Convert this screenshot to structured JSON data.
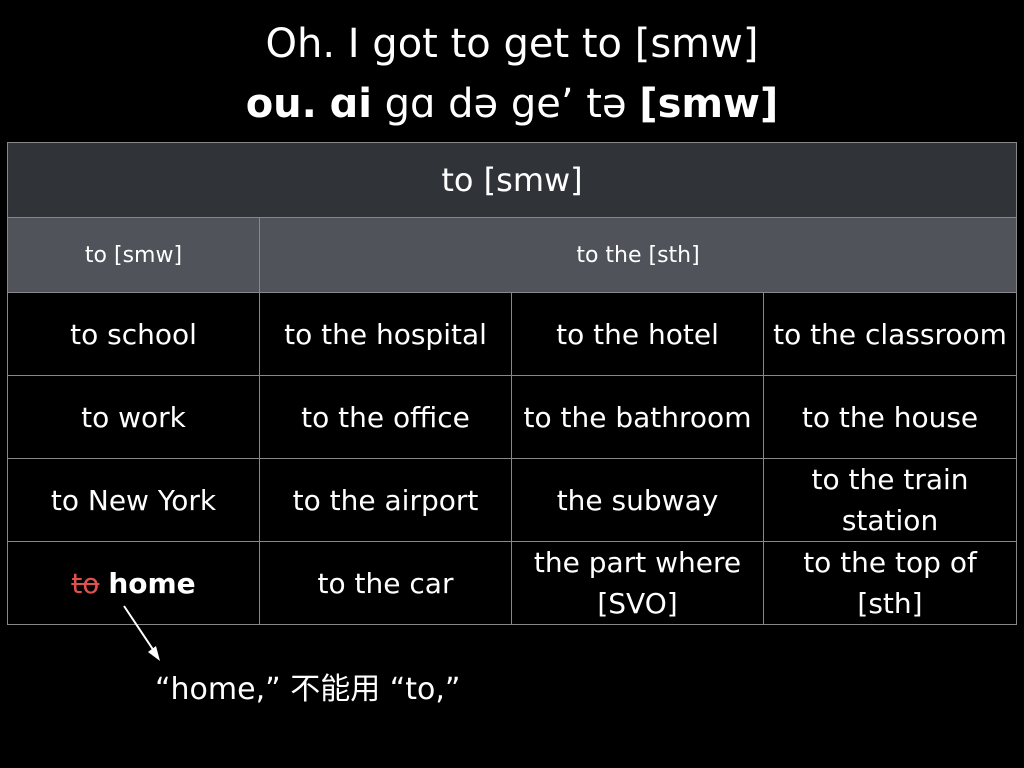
{
  "slide": {
    "title_line1": "Oh. I got to get to [smw]",
    "title_line2": {
      "part1_bold": "ou.",
      "part2": " ",
      "part3_bold": "ɑi",
      "part4": " gɑ də ge’ tə ",
      "part5_bold": "[smw]"
    }
  },
  "table": {
    "header": "to [smw]",
    "subheaders": [
      "to [smw]",
      "to the [sth]"
    ],
    "rows": [
      [
        "to school",
        "to the hospital",
        "to the hotel",
        "to the classroom"
      ],
      [
        "to work",
        "to the office",
        "to the bathroom",
        "to the house"
      ],
      [
        "to New York",
        "to the airport",
        "the subway",
        "to the train station"
      ],
      [
        "",
        "to the car",
        "the part where [SVO]",
        "to the top of [sth]"
      ]
    ],
    "special_cell": {
      "struck": "to",
      "bold": "home"
    }
  },
  "note": "“home,” 不能用 “to,”",
  "colors": {
    "background": "#000000",
    "header_bg": "#303338",
    "subheader_bg": "#50535a",
    "strike_red": "#e0514d",
    "grid_line": "#888888"
  }
}
